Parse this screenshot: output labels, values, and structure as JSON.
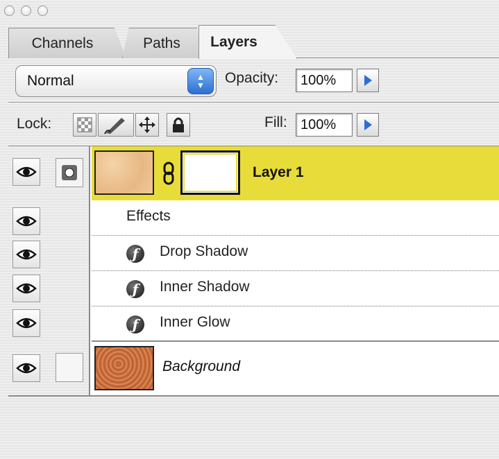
{
  "tabs": {
    "channels": "Channels",
    "paths": "Paths",
    "layers": "Layers"
  },
  "blend": {
    "mode": "Normal",
    "opacity_label": "Opacity:",
    "opacity_value": "100%"
  },
  "lock": {
    "label": "Lock:",
    "fill_label": "Fill:",
    "fill_value": "100%"
  },
  "layers": {
    "layer1": {
      "name": "Layer 1"
    },
    "effects_header": "Effects",
    "effects": [
      "Drop Shadow",
      "Inner Shadow",
      "Inner Glow"
    ],
    "background": {
      "name": "Background"
    }
  },
  "colors": {
    "selected_layer": "#e8dc3a",
    "accent_blue": "#2c6ed4"
  },
  "icons": [
    "eye-icon",
    "layer-mask-link-icon",
    "chain-link-icon",
    "fx-icon",
    "lock-transparent-icon",
    "lock-paint-icon",
    "lock-move-icon",
    "lock-all-icon",
    "play-triangle-icon",
    "up-down-arrows-icon"
  ]
}
